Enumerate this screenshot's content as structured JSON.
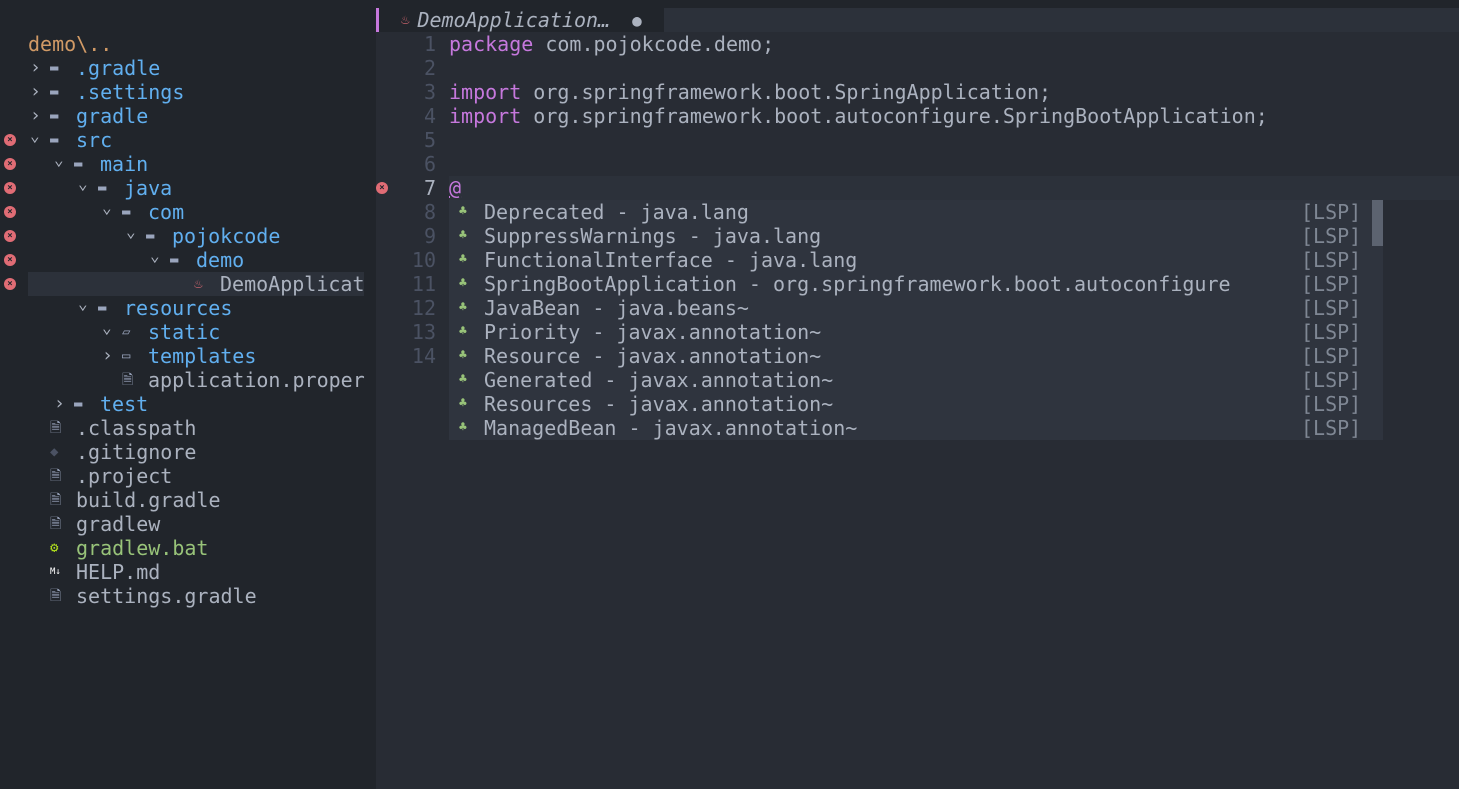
{
  "tabline": {
    "tab_title": "DemoApplication…",
    "modified_indicator": "●",
    "tab_icon": "java-icon"
  },
  "sidebar": {
    "root": "demo\\..",
    "items": [
      {
        "name": ".gradle",
        "level": 0,
        "type": "dir",
        "expanded": false,
        "error": false
      },
      {
        "name": ".settings",
        "level": 0,
        "type": "dir",
        "expanded": false,
        "error": false
      },
      {
        "name": "gradle",
        "level": 0,
        "type": "dir",
        "expanded": false,
        "error": false
      },
      {
        "name": "src",
        "level": 0,
        "type": "dir",
        "expanded": true,
        "error": true
      },
      {
        "name": "main",
        "level": 1,
        "type": "dir",
        "expanded": true,
        "error": true
      },
      {
        "name": "java",
        "level": 2,
        "type": "dir",
        "expanded": true,
        "error": true
      },
      {
        "name": "com",
        "level": 3,
        "type": "dir",
        "expanded": true,
        "error": true
      },
      {
        "name": "pojokcode",
        "level": 4,
        "type": "dir",
        "expanded": true,
        "error": true
      },
      {
        "name": "demo",
        "level": 5,
        "type": "dir",
        "expanded": true,
        "error": true
      },
      {
        "name": "DemoApplicat",
        "level": 6,
        "type": "java",
        "error": true,
        "selected": true
      },
      {
        "name": "resources",
        "level": 2,
        "type": "dir",
        "expanded": true,
        "error": false
      },
      {
        "name": "static",
        "level": 3,
        "type": "emptydir",
        "expanded": true,
        "error": false
      },
      {
        "name": "templates",
        "level": 3,
        "type": "emptydir",
        "expanded": false,
        "error": false
      },
      {
        "name": "application.proper",
        "level": 3,
        "type": "file",
        "error": false
      },
      {
        "name": "test",
        "level": 1,
        "type": "dir",
        "expanded": false,
        "error": false
      },
      {
        "name": ".classpath",
        "level": 0,
        "type": "file",
        "error": false
      },
      {
        "name": ".gitignore",
        "level": 0,
        "type": "git",
        "error": false
      },
      {
        "name": ".project",
        "level": 0,
        "type": "file",
        "error": false
      },
      {
        "name": "build.gradle",
        "level": 0,
        "type": "file",
        "error": false
      },
      {
        "name": "gradlew",
        "level": 0,
        "type": "file",
        "error": false
      },
      {
        "name": "gradlew.bat",
        "level": 0,
        "type": "bat",
        "error": false
      },
      {
        "name": "HELP.md",
        "level": 0,
        "type": "md",
        "error": false
      },
      {
        "name": "settings.gradle",
        "level": 0,
        "type": "file",
        "error": false
      }
    ]
  },
  "editor": {
    "lines": [
      {
        "n": "1",
        "kw": "package",
        "rest": " com.pojokcode.demo;"
      },
      {
        "n": "2",
        "kw": "",
        "rest": ""
      },
      {
        "n": "3",
        "kw": "import",
        "rest": " org.springframework.boot.SpringApplication;"
      },
      {
        "n": "4",
        "kw": "import",
        "rest": " org.springframework.boot.autoconfigure.SpringBootApplication;"
      },
      {
        "n": "5",
        "kw": "",
        "rest": ""
      },
      {
        "n": "6",
        "kw": "",
        "rest": ""
      },
      {
        "n": "7",
        "kw": "@",
        "rest": ""
      },
      {
        "n": "8"
      },
      {
        "n": "9"
      },
      {
        "n": "10"
      },
      {
        "n": "11"
      },
      {
        "n": "12"
      },
      {
        "n": "13"
      },
      {
        "n": "14"
      }
    ],
    "cursor_line": "7",
    "error_line": "7"
  },
  "completion": {
    "items": [
      {
        "label": "Deprecated - java.lang",
        "source": "[LSP]"
      },
      {
        "label": "SuppressWarnings - java.lang",
        "source": "[LSP]"
      },
      {
        "label": "FunctionalInterface - java.lang",
        "source": "[LSP]"
      },
      {
        "label": "SpringBootApplication - org.springframework.boot.autoconfigure",
        "source": "[LSP]"
      },
      {
        "label": "JavaBean - java.beans~",
        "source": "[LSP]"
      },
      {
        "label": "Priority - javax.annotation~",
        "source": "[LSP]"
      },
      {
        "label": "Resource - javax.annotation~",
        "source": "[LSP]"
      },
      {
        "label": "Generated - javax.annotation~",
        "source": "[LSP]"
      },
      {
        "label": "Resources - javax.annotation~",
        "source": "[LSP]"
      },
      {
        "label": "ManagedBean - javax.annotation~",
        "source": "[LSP]"
      }
    ]
  },
  "colors": {
    "accent": "#c678dd",
    "error": "#e06c75",
    "dir": "#61afef",
    "keyword": "#c678dd"
  }
}
